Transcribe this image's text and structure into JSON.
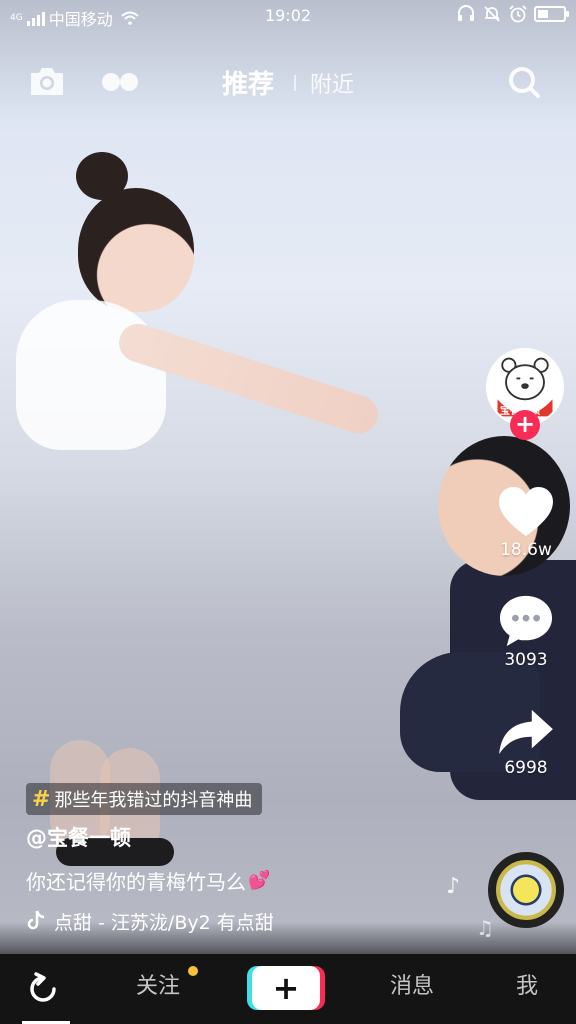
{
  "status_bar": {
    "network": "4G",
    "carrier": "中国移动",
    "time": "19:02"
  },
  "top_nav": {
    "tab_recommend": "推荐",
    "tab_nearby": "附近"
  },
  "right_rail": {
    "avatar_label": "宝餐一顿",
    "likes": "18.6w",
    "comments": "3093",
    "shares": "6998"
  },
  "video_info": {
    "hashtag": "那些年我错过的抖音神曲",
    "author": "@宝餐一顿",
    "caption": "你还记得你的青梅竹马么",
    "caption_emoji": "💕",
    "music": "点甜 - 汪苏泷/By2    有点甜"
  },
  "tab_bar": {
    "home_icon": "refresh-icon",
    "follow": "关注",
    "add": "+",
    "messages": "消息",
    "me": "我"
  },
  "colors": {
    "accent_red": "#f72d55",
    "accent_cyan": "#3ee0e8",
    "hashtag_yellow": "#f8d24a",
    "tabbar_bg": "#141414"
  }
}
